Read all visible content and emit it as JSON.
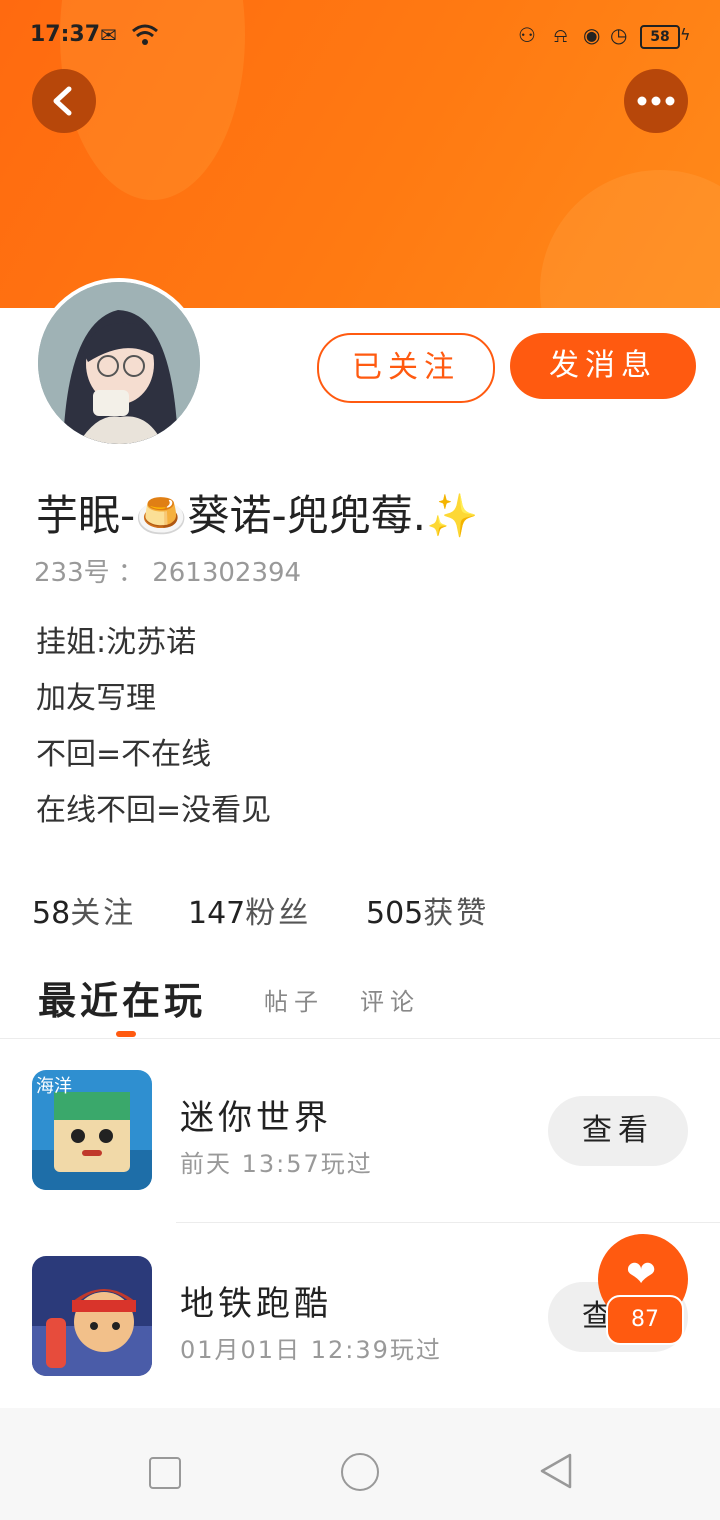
{
  "status_bar": {
    "time": "17:37",
    "battery": "58"
  },
  "profile": {
    "name": "芋眠-🍮葵诺-兜兜莓.✨",
    "uid_label": "233号",
    "uid_sep": "：",
    "uid_value": "261302394",
    "bio": [
      "挂姐:沈苏诺",
      "加友写理",
      "不回=不在线",
      "在线不回=没看见"
    ],
    "follow_button": "已关注",
    "message_button": "发消息"
  },
  "stats": {
    "following_count": "58",
    "following_label": "关注",
    "followers_count": "147",
    "followers_label": "粉丝",
    "likes_count": "505",
    "likes_label": "获赞"
  },
  "tabs": {
    "active": "最近在玩",
    "posts": "帖子",
    "comments": "评论"
  },
  "games": [
    {
      "name": "迷你世界",
      "last_played": "前天 13:57玩过",
      "button": "查看",
      "icon_text": "海洋"
    },
    {
      "name": "地铁跑酷",
      "last_played": "01月01日 12:39玩过",
      "button": "查看"
    }
  ],
  "fab": {
    "count": "87"
  },
  "colors": {
    "accent": "#ff5a10",
    "header": "#ff7a12"
  },
  "icons": [
    "back-icon",
    "more-icon",
    "heart-icon",
    "nav-recents-icon",
    "nav-home-icon",
    "nav-back-icon"
  ]
}
